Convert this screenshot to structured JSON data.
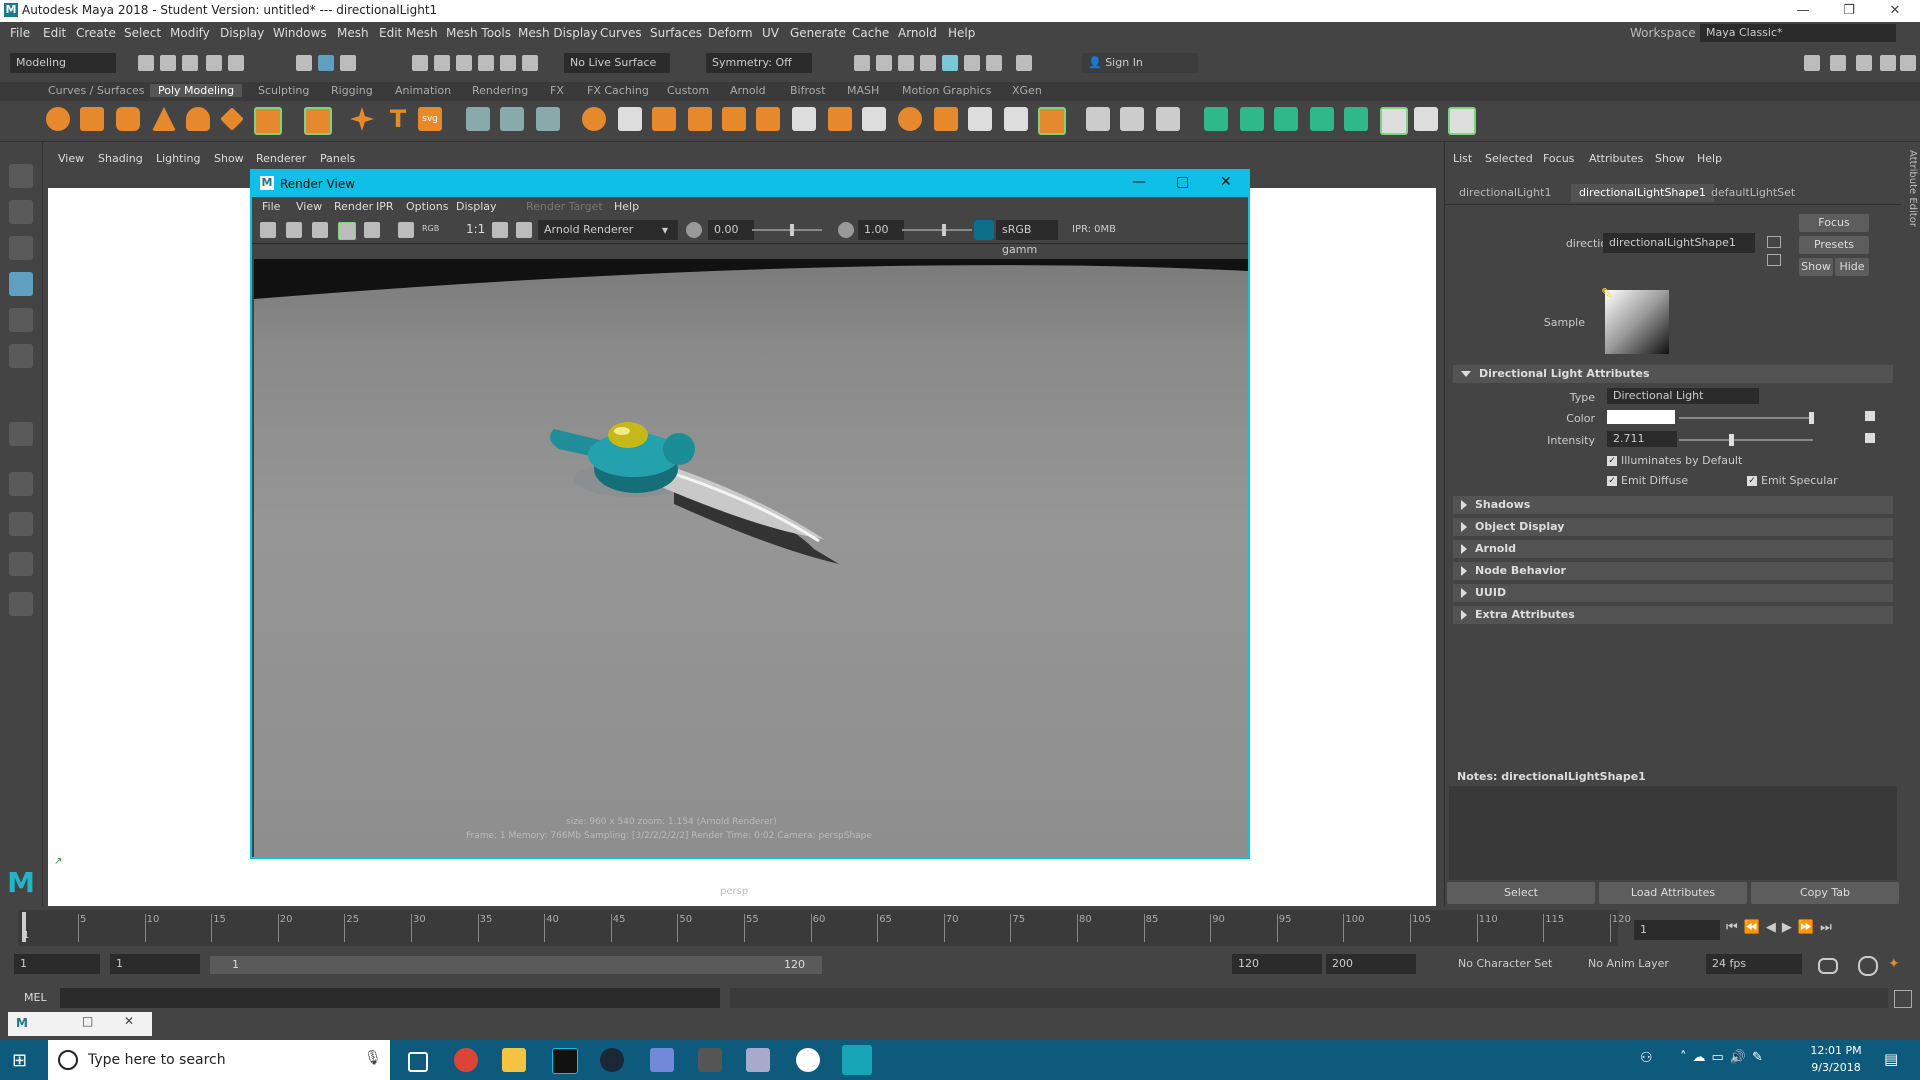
{
  "window": {
    "title": "Autodesk Maya 2018 - Student Version: untitled*   ---   directionalLight1",
    "logo": "M",
    "minimize": "—",
    "maximize": "❐",
    "close": "✕"
  },
  "menubar": [
    "File",
    "Edit",
    "Create",
    "Select",
    "Modify",
    "Display",
    "Windows",
    "Mesh",
    "Edit Mesh",
    "Mesh Tools",
    "Mesh Display",
    "Curves",
    "Surfaces",
    "Deform",
    "UV",
    "Generate",
    "Cache",
    "Arnold",
    "Help"
  ],
  "workspace": {
    "label": "Workspace :",
    "value": "Maya Classic*"
  },
  "statusline": {
    "mode": "Modeling",
    "live_surface": "No Live Surface",
    "symmetry": "Symmetry: Off",
    "sign_in": "Sign In"
  },
  "shelf_tabs": [
    "Curves / Surfaces",
    "Poly Modeling",
    "Sculpting",
    "Rigging",
    "Animation",
    "Rendering",
    "FX",
    "FX Caching",
    "Custom",
    "Arnold",
    "Bifrost",
    "MASH",
    "Motion Graphics",
    "XGen"
  ],
  "viewport_menu": [
    "View",
    "Shading",
    "Lighting",
    "Show",
    "Renderer",
    "Panels"
  ],
  "viewport_camera": "persp",
  "render_view": {
    "title": "Render View",
    "icon": "M",
    "menu": [
      "File",
      "View",
      "Render",
      "IPR",
      "Options",
      "Display",
      "Render Target",
      "Help"
    ],
    "one_to_one": "1:1",
    "rgb": "RGB",
    "renderer": "Arnold Renderer",
    "exposure": "0.00",
    "gamma": "1.00",
    "color_space": "sRGB gamm",
    "ipr": "IPR: 0MB",
    "info_line1": "size: 960 x 540  zoom: 1.154       (Arnold Renderer)",
    "info_line2": "Frame: 1     Memory: 766Mb     Sampling: [3/2/2/2/2/2]     Render Time: 0:02     Camera: perspShape"
  },
  "attribute_editor": {
    "menu": [
      "List",
      "Selected",
      "Focus",
      "Attributes",
      "Show",
      "Help"
    ],
    "tabs": [
      "directionalLight1",
      "directionalLightShape1",
      "defaultLightSet"
    ],
    "active_tab": 1,
    "node_label": "directionalLight:",
    "node_value": "directionalLightShape1",
    "focus": "Focus",
    "presets": "Presets",
    "show": "Show",
    "hide": "Hide",
    "sample_label": "Sample",
    "section_open": "Directional Light Attributes",
    "type_label": "Type",
    "type_value": "Directional Light",
    "color_label": "Color",
    "intensity_label": "Intensity",
    "intensity_value": "2.711",
    "illuminates": "Illuminates by Default",
    "emit_diffuse": "Emit Diffuse",
    "emit_specular": "Emit Specular",
    "sections_closed": [
      "Shadows",
      "Object Display",
      "Arnold",
      "Node Behavior",
      "UUID",
      "Extra Attributes"
    ],
    "notes_label": "Notes:  directionalLightShape1",
    "bottom_buttons": [
      "Select",
      "Load Attributes",
      "Copy Tab"
    ],
    "side_label": "Attribute Editor"
  },
  "timeline": {
    "ticks": [
      "5",
      "10",
      "15",
      "20",
      "25",
      "30",
      "35",
      "40",
      "45",
      "50",
      "55",
      "60",
      "65",
      "70",
      "75",
      "80",
      "85",
      "90",
      "95",
      "100",
      "105",
      "110",
      "115",
      "120"
    ],
    "start_marker": "1",
    "current_frame": "1"
  },
  "range": {
    "start": "1",
    "anim_start": "1",
    "slider_start": "1",
    "slider_end": "120",
    "end": "120",
    "anim_end": "200",
    "character": "No Character Set",
    "anim_layer": "No Anim Layer",
    "fps": "24 fps"
  },
  "cmdline": {
    "label": "MEL"
  },
  "taskbar": {
    "search_placeholder": "Type here to search",
    "time": "12:01 PM",
    "date": "9/3/2018"
  },
  "colors": {
    "accent": "#0ec0e6",
    "taskbar": "#0e5a7c",
    "maya_bg": "#444444"
  }
}
